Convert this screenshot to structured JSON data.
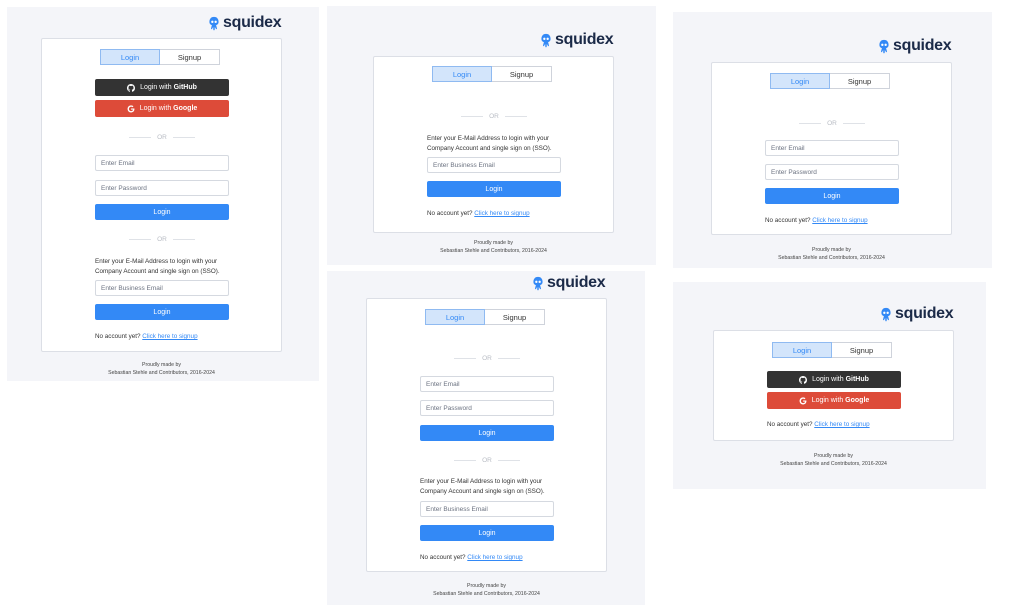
{
  "logo": {
    "text": "squidex"
  },
  "tabs": {
    "login": "Login",
    "signup": "Signup"
  },
  "buttons": {
    "github_prefix": "Login with",
    "github_brand": "GitHub",
    "google_prefix": "Login with",
    "google_brand": "Google",
    "login": "Login"
  },
  "divider": "OR",
  "inputs": {
    "email_placeholder": "Enter Email",
    "password_placeholder": "Enter Password",
    "business_email_placeholder": "Enter Business Email"
  },
  "sso": {
    "line1": "Enter your E-Mail Address to login with your",
    "line2": "Company Account and single sign on (SSO)."
  },
  "signup_prompt": {
    "text": "No account yet?",
    "link": "Click here to signup"
  },
  "footer": {
    "line1": "Proudly made by",
    "line2": "Sebastian Stehle and Contributors, 2016-2024"
  },
  "colors": {
    "primary": "#3389f6",
    "github": "#333333",
    "google": "#dd4b39",
    "panel": "#f4f5f9",
    "logo": "#1b2a48"
  },
  "icons": [
    "squid-logo-icon",
    "github-icon",
    "google-icon"
  ]
}
